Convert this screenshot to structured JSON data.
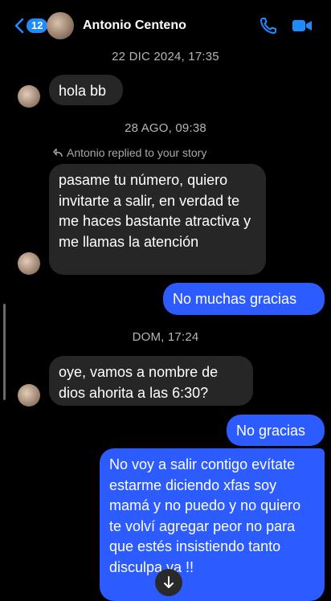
{
  "header": {
    "back_badge": "12",
    "contact_name": "Antonio Centeno"
  },
  "messages": {
    "ts1": "22 DIC 2024, 17:35",
    "m1": "hola bb",
    "ts2": "28 AGO, 09:38",
    "reply_note": "Antonio replied to your story",
    "m2": "pasame tu número, quiero invitarte a salir, en verdad te me haces bastante atractiva y me llamas la atención",
    "m3": "No muchas gracias",
    "ts3": "DOM, 17:24",
    "m4": "oye, vamos a nombre de dios ahorita a las 6:30?",
    "m5": "No gracias",
    "m6": "No voy a salir contigo evítate estarme diciendo xfas soy mamá y no puedo y no quiero te volví agregar peor no para que estés insistiendo tanto disculpa va !!"
  },
  "colors": {
    "accent": "#1f8bff",
    "sent_bubble": "#2c5bff",
    "received_bubble": "#262626",
    "background": "#000000"
  },
  "icons": [
    "chevron-left-icon",
    "phone-icon",
    "video-camera-icon",
    "reply-arrow-icon",
    "arrow-down-icon"
  ]
}
